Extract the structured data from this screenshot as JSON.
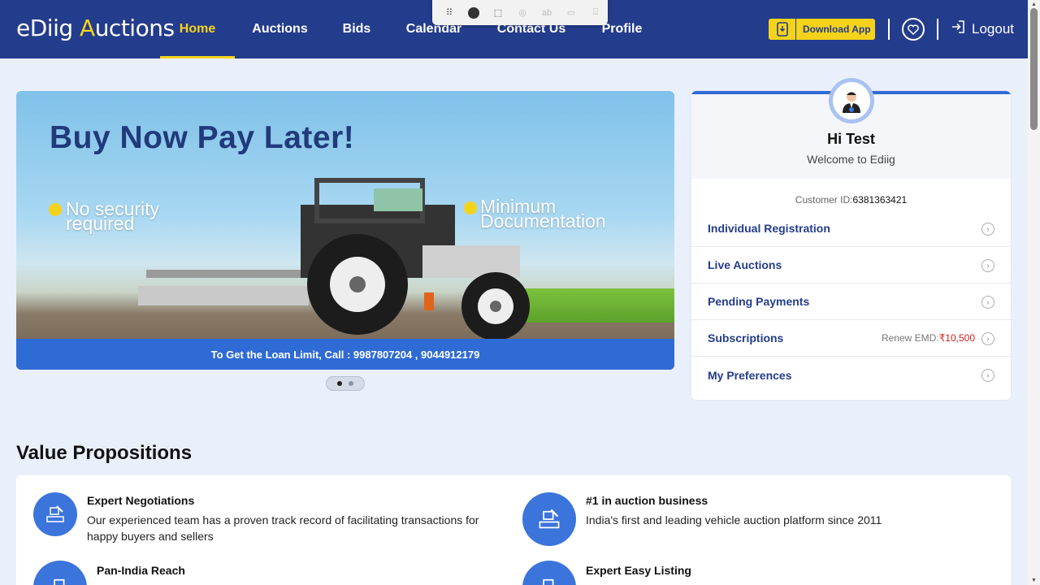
{
  "header": {
    "logo_part1": "eDiig ",
    "logo_part2": "A",
    "logo_part3": "uctions",
    "nav": [
      "Home",
      "Auctions",
      "Bids",
      "Calendar",
      "Contact Us",
      "Profile"
    ],
    "active_nav": "Home",
    "download_label": "Download App",
    "logout_label": "Logout"
  },
  "banner": {
    "headline": "Buy Now Pay Later!",
    "bullet1_line1": "No security",
    "bullet1_line2": "required",
    "bullet2_line1": "Minimum",
    "bullet2_line2": "Documentation",
    "strip_text": "To Get the Loan Limit, Call : 9987807204 , 9044912179"
  },
  "profile": {
    "greeting": "Hi Test",
    "welcome": "Welcome to Ediig",
    "customer_id_label": "Customer ID:",
    "customer_id": "6381363421",
    "menu": [
      {
        "label": "Individual Registration"
      },
      {
        "label": "Live Auctions"
      },
      {
        "label": "Pending Payments"
      },
      {
        "label": "Subscriptions",
        "renew_label": "Renew EMD:",
        "renew_amount": "₹10,500"
      },
      {
        "label": "My Preferences"
      }
    ]
  },
  "value_props": {
    "title": "Value Propositions",
    "items": [
      {
        "title": "Expert Negotiations",
        "desc_line1": "Our experienced team has a proven track record of facilitating transactions for",
        "desc_line2": "happy buyers and sellers"
      },
      {
        "title": "#1 in auction business",
        "desc_line1": "India's first and leading vehicle auction platform since 2011"
      },
      {
        "title": "Pan-India Reach"
      },
      {
        "title": "Expert Easy Listing"
      }
    ]
  },
  "colors": {
    "nav_bg": "#243c8c",
    "accent": "#f5d31a",
    "link": "#243c8c",
    "price": "#d61c1c"
  }
}
